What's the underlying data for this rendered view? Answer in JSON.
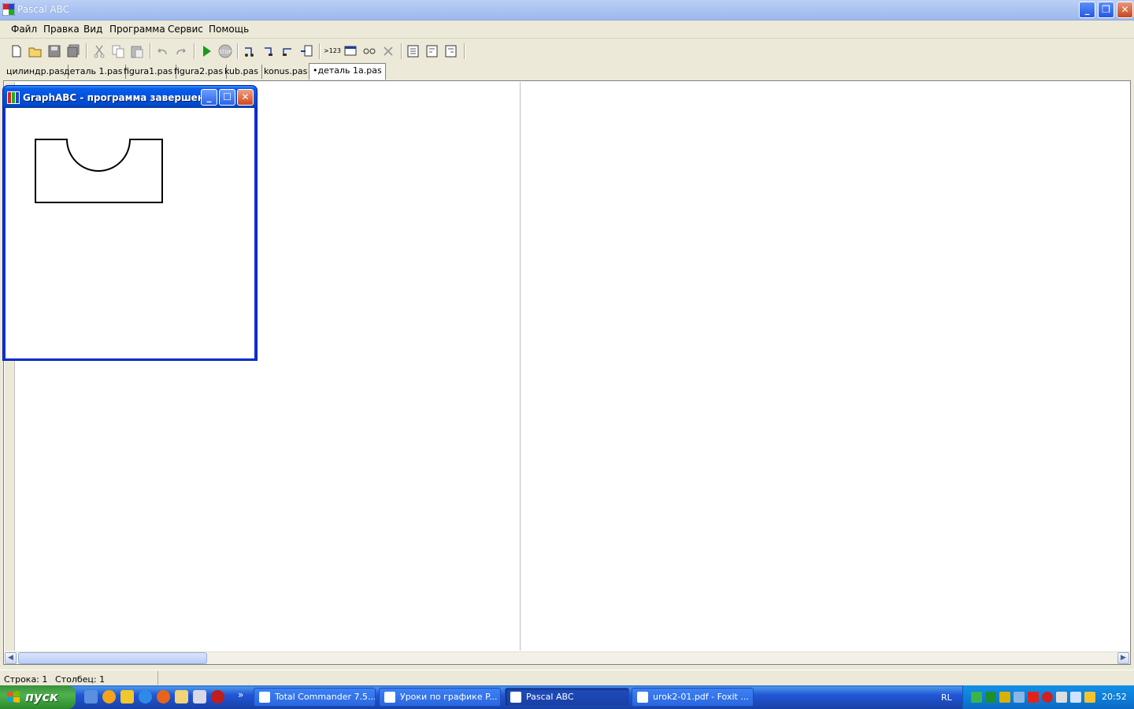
{
  "window": {
    "title": "Pascal ABC",
    "minimize_glyph": "_",
    "restore_glyph": "❐",
    "close_glyph": "✕"
  },
  "menu": [
    "Файл",
    "Правка",
    "Вид",
    "Программа",
    "Сервис",
    "Помощь"
  ],
  "toolbar": {
    "buttons": [
      "new-file",
      "open-file",
      "save-file",
      "save-all",
      "cut",
      "copy",
      "paste",
      "undo",
      "redo",
      "run",
      "stop",
      "step-into",
      "step-over",
      "step-out",
      "run-to-cursor",
      "output-numbers",
      "output-window",
      "watch",
      "close",
      "view-1",
      "view-2",
      "view-3"
    ],
    "output_label": ">123"
  },
  "tabs": [
    {
      "label": "цилиндр.pas",
      "active": false
    },
    {
      "label": "деталь 1.pas",
      "active": false
    },
    {
      "label": "figura1.pas",
      "active": false
    },
    {
      "label": "figura2.pas",
      "active": false
    },
    {
      "label": "kub.pas",
      "active": false
    },
    {
      "label": "konus.pas",
      "active": false
    },
    {
      "label": "•деталь 1a.pas",
      "active": true
    }
  ],
  "graph_window": {
    "title": "GraphABC - программа завершена",
    "minimize_glyph": "_",
    "maximize_glyph": "☐",
    "close_glyph": "✕"
  },
  "status": {
    "line": "Строка: 1",
    "column": "Столбец: 1"
  },
  "taskbar": {
    "start_label": "пуск",
    "more_glyph": "»",
    "tasks": [
      {
        "label": "Total Commander 7.5..."
      },
      {
        "label": "Уроки по графике P..."
      },
      {
        "label": "Pascal ABC"
      },
      {
        "label": "urok2-01.pdf - Foxit ..."
      }
    ],
    "lang": "RL",
    "clock": "20:52"
  },
  "colors": {
    "xp_blue": "#0054e3",
    "editor_bg": "#ffffff",
    "face": "#ece9d8"
  }
}
